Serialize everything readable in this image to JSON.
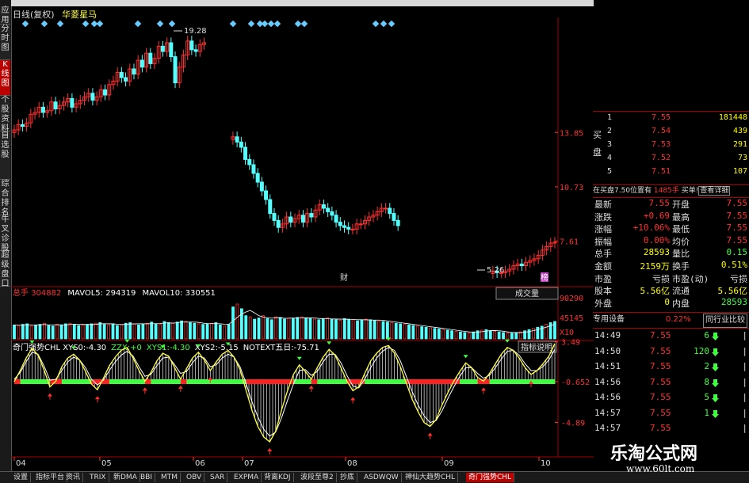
{
  "sidebar": [
    "应用",
    "分时图",
    "K线图",
    "个股资料",
    "自选股",
    "综合排名",
    "牛叉诊股",
    "超级盘口"
  ],
  "sidebar_active": 2,
  "header": {
    "period": "日线(复权)",
    "name": "华菱星马"
  },
  "chart_data": [
    {
      "type": "candlestick",
      "title": "日线(复权) 华菱星马",
      "y_ticks": [
        "13.85",
        "10.73",
        "7.61"
      ],
      "annotations": [
        {
          "label": "19.28",
          "kind": "high"
        },
        {
          "label": "5.26",
          "kind": "low"
        },
        {
          "label": "财",
          "kind": "marker"
        },
        {
          "label": "榜",
          "kind": "marker"
        }
      ],
      "x_ticks": [
        "04",
        "05",
        "06",
        "07",
        "08",
        "09",
        "10"
      ],
      "close": [
        14.0,
        14.3,
        14.2,
        14.4,
        14.9,
        15.0,
        15.3,
        15.0,
        15.1,
        15.6,
        15.2,
        15.4,
        15.6,
        15.8,
        15.3,
        15.5,
        15.7,
        15.9,
        16.1,
        15.7,
        15.9,
        16.3,
        16.0,
        16.6,
        16.8,
        17.3,
        17.0,
        16.8,
        17.5,
        17.2,
        18.0,
        17.6,
        18.4,
        17.8,
        18.1,
        18.8,
        18.5,
        19.0,
        18.2,
        16.7,
        17.6,
        18.3,
        19.1,
        18.6,
        18.5,
        18.9,
        19.0,
        null,
        null,
        null,
        null,
        null,
        null,
        13.6,
        13.3,
        13.0,
        12.3,
        12.0,
        11.5,
        11.0,
        10.5,
        10.0,
        9.2,
        8.8,
        8.4,
        8.6,
        9.0,
        8.7,
        8.9,
        9.1,
        8.7,
        9.2,
        9.0,
        9.4,
        9.7,
        9.5,
        9.3,
        9.1,
        8.7,
        8.5,
        8.4,
        8.3,
        8.3,
        8.6,
        8.6,
        8.8,
        9.0,
        9.1,
        9.3,
        9.5,
        9.5,
        9.2,
        8.8,
        8.5,
        null,
        null,
        null,
        null,
        null,
        null,
        null,
        null,
        null,
        null,
        null,
        null,
        null,
        null,
        null,
        null,
        null,
        null,
        null,
        null,
        null,
        null,
        5.9,
        5.8,
        5.8,
        5.9,
        6.0,
        6.2,
        6.3,
        6.2,
        6.4,
        6.5,
        6.6,
        6.8,
        7.1,
        7.3,
        7.5,
        7.55
      ]
    },
    {
      "type": "bar",
      "title": "总手",
      "legend": [
        {
          "label": "总手",
          "value": "304882"
        },
        {
          "label": "MAVOL5",
          "value": "294319"
        },
        {
          "label": "MAVOL10",
          "value": "330551"
        }
      ],
      "y_ticks": [
        "90290",
        "45145",
        "X10"
      ],
      "volume": [
        24,
        23,
        25,
        26,
        22,
        24,
        25,
        27,
        23,
        22,
        25,
        24,
        26,
        27,
        25,
        23,
        24,
        25,
        26,
        27,
        28,
        25,
        24,
        26,
        23,
        25,
        27,
        28,
        26,
        24,
        25,
        27,
        29,
        26,
        25,
        30,
        28,
        27,
        29,
        31,
        30,
        28,
        27,
        26,
        25,
        26,
        27,
        28,
        24,
        22,
        25,
        55,
        60,
        52,
        40,
        38,
        34,
        36,
        40,
        35,
        33,
        38,
        37,
        34,
        36,
        35,
        37,
        38,
        36,
        35,
        34,
        33,
        35,
        36,
        34,
        33,
        32,
        35,
        34,
        33,
        31,
        32,
        34,
        33,
        32,
        31,
        30,
        29,
        28,
        27,
        26,
        25,
        24,
        23,
        22,
        21,
        20,
        19,
        18,
        17,
        16,
        15,
        14,
        13,
        12,
        11,
        10,
        12,
        14,
        15,
        16,
        14,
        13,
        12,
        11,
        10,
        10,
        11,
        12,
        14,
        16,
        18,
        20,
        22,
        25,
        28,
        30
      ],
      "dropdown": "成交量"
    },
    {
      "type": "line",
      "title": "奇门强势CHL",
      "legend": [
        {
          "label": "奇门强势CHL XYS0",
          "value": "-4.30"
        },
        {
          "label": "ZZX",
          "value": "+0"
        },
        {
          "label": "XYS1",
          "value": "-4.30"
        },
        {
          "label": "XYS2",
          "value": "-5.15"
        },
        {
          "label": "NOTEXT五日",
          "value": "-75.71"
        }
      ],
      "y_ticks": [
        "3.49",
        "-0.652",
        "-4.89"
      ],
      "series": [
        {
          "name": "XYS1",
          "values": [
            -0.65,
            0.5,
            1.8,
            2.8,
            2.1,
            0.6,
            -1.2,
            -0.6,
            0.9,
            1.8,
            2.2,
            1.6,
            0.4,
            -0.9,
            -1.5,
            -0.3,
            1.0,
            1.9,
            2.6,
            2.9,
            1.8,
            0.5,
            -0.6,
            0.3,
            1.5,
            2.3,
            2.0,
            0.8,
            -0.4,
            0.7,
            1.8,
            2.4,
            1.6,
            0.5,
            1.4,
            2.2,
            2.6,
            1.9,
            0.6,
            -1.5,
            -3.6,
            -5.3,
            -6.4,
            -6.9,
            -5.8,
            -3.6,
            -1.6,
            0.1,
            1.1,
            0.4,
            -0.4,
            0.8,
            1.9,
            2.7,
            2.1,
            0.8,
            -0.6,
            -1.6,
            -1.2,
            0.2,
            1.5,
            2.3,
            2.9,
            3.1,
            2.3,
            0.9,
            -0.8,
            -2.5,
            -3.8,
            -4.9,
            -5.3,
            -4.6,
            -3.1,
            -1.8,
            -0.6,
            0.4,
            1.3,
            0.8,
            -0.2,
            -0.6,
            0.2,
            1.2,
            2.2,
            2.9,
            2.6,
            1.8,
            0.8,
            0.1,
            0.5,
            1.2,
            2.0,
            3.3
          ]
        },
        {
          "name": "XYS2",
          "values": [
            -0.4,
            0.3,
            1.4,
            2.4,
            2.2,
            1.0,
            -0.5,
            -0.4,
            0.5,
            1.4,
            1.9,
            1.6,
            0.8,
            -0.4,
            -1.0,
            -0.5,
            0.5,
            1.4,
            2.1,
            2.5,
            2.0,
            0.9,
            -0.1,
            0.1,
            1.0,
            1.8,
            1.9,
            1.1,
            0.2,
            0.4,
            1.3,
            2.0,
            1.8,
            0.9,
            1.1,
            1.8,
            2.2,
            1.9,
            0.9,
            -0.8,
            -2.7,
            -4.3,
            -5.6,
            -6.3,
            -5.9,
            -4.4,
            -2.6,
            -0.9,
            0.5,
            0.6,
            0.0,
            0.4,
            1.4,
            2.2,
            2.2,
            1.3,
            0.0,
            -1.1,
            -1.3,
            -0.4,
            0.8,
            1.8,
            2.5,
            2.9,
            2.6,
            1.5,
            -0.1,
            -1.7,
            -3.1,
            -4.2,
            -4.9,
            -4.7,
            -3.7,
            -2.4,
            -1.2,
            -0.1,
            0.8,
            0.8,
            0.2,
            -0.3,
            0.0,
            0.8,
            1.7,
            2.5,
            2.6,
            2.1,
            1.2,
            0.5,
            0.5,
            0.9,
            1.6,
            2.7
          ]
        }
      ],
      "markers": "buy/sell arrows",
      "button": "指标说明"
    }
  ],
  "quote": {
    "bid_label": "买盘",
    "bids": [
      {
        "level": "1",
        "price": "7.55",
        "vol": "181448"
      },
      {
        "level": "2",
        "price": "7.54",
        "vol": "439"
      },
      {
        "level": "3",
        "price": "7.53",
        "vol": "291"
      },
      {
        "level": "4",
        "price": "7.52",
        "vol": "73"
      },
      {
        "level": "5",
        "price": "7.51",
        "vol": "107"
      }
    ],
    "notice": "在买盘7.50位置有",
    "notice_vol": "1485手",
    "notice_buy": "买单!",
    "notice_link": "查看详细",
    "fields": [
      {
        "l1": "最新",
        "v1": "7.55",
        "l2": "开盘",
        "v2": "7.55"
      },
      {
        "l1": "涨跌",
        "v1": "+0.69",
        "l2": "最高",
        "v2": "7.55"
      },
      {
        "l1": "涨幅",
        "v1": "+10.06%",
        "l2": "最低",
        "v2": "7.55"
      },
      {
        "l1": "振幅",
        "v1": "0.00%",
        "l2": "均价",
        "v2": "7.55"
      },
      {
        "l1": "总手",
        "v1": "28593",
        "l2": "量比",
        "v2": "0.15"
      },
      {
        "l1": "金额",
        "v1": "2159万",
        "l2": "换手",
        "v2": "0.51%"
      },
      {
        "l1": "市盈",
        "v1": "亏损",
        "l2": "市盈(动)",
        "v2": "亏损"
      },
      {
        "l1": "股本",
        "v1": "5.56亿",
        "l2": "流通",
        "v2": "5.56亿"
      },
      {
        "l1": "外盘",
        "v1": "0",
        "l2": "内盘",
        "v2": "28593"
      }
    ],
    "sector": "专用设备",
    "sector_pct": "0.22%",
    "sector_btn": "同行业比较",
    "ticks": [
      {
        "t": "14:49",
        "p": "7.55",
        "v": "6",
        "d": "down"
      },
      {
        "t": "14:50",
        "p": "7.55",
        "v": "120",
        "d": "down"
      },
      {
        "t": "14:51",
        "p": "7.55",
        "v": "2",
        "d": "down"
      },
      {
        "t": "14:56",
        "p": "7.55",
        "v": "8",
        "d": "down"
      },
      {
        "t": "14:56",
        "p": "7.55",
        "v": "5",
        "d": "down"
      },
      {
        "t": "14:57",
        "p": "7.55",
        "v": "1",
        "d": "down"
      },
      {
        "t": "14:57",
        "p": "7.55",
        "v": "",
        "d": ""
      }
    ]
  },
  "bottom_tabs": [
    "设置",
    "指标平台",
    "资讯",
    "TRIX",
    "新DMA",
    "BBI",
    "MTM",
    "OBV",
    "SAR",
    "EXPMA",
    "背离KDJ",
    "波段至尊2",
    "抄底",
    "ASDWQW",
    "神仙大趋势CHL",
    "奇门强势CHL"
  ],
  "bottom_active": 15,
  "watermark": {
    "line1": "乐淘公式网",
    "line2": "www.60lt.com"
  },
  "colors": {
    "up": "#ff3030",
    "down": "#54ffff",
    "yellow": "#ffff40",
    "green": "#40ff40",
    "white": "#ffffff"
  }
}
